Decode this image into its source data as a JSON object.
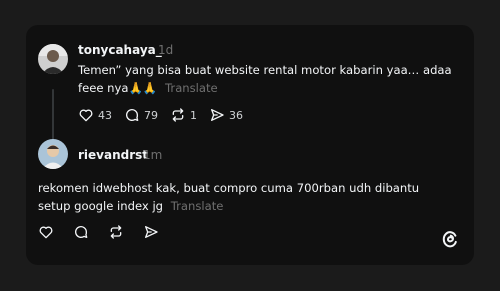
{
  "post1": {
    "username": "tonycahaya_",
    "time": "1d",
    "text": "Temen” yang bisa buat website rental motor kabarin yaa… adaa feee nya🙏🙏",
    "translate_label": "Translate",
    "likes": "43",
    "replies": "79",
    "reposts": "1",
    "shares": "36"
  },
  "post2": {
    "username": "rievandrst",
    "time": "1m",
    "text": "rekomen idwebhost kak, buat compro cuma 700rban udh dibantu setup google index jg",
    "translate_label": "Translate"
  },
  "colors": {
    "page_background": "#1b1b1b",
    "card_background": "#101010",
    "text_primary": "#f3f5f7",
    "text_muted": "#6f6f6f"
  },
  "icons": {
    "like": "heart-icon",
    "reply": "comment-icon",
    "repost": "repost-icon",
    "share": "send-icon",
    "brand": "threads-logo-icon"
  }
}
